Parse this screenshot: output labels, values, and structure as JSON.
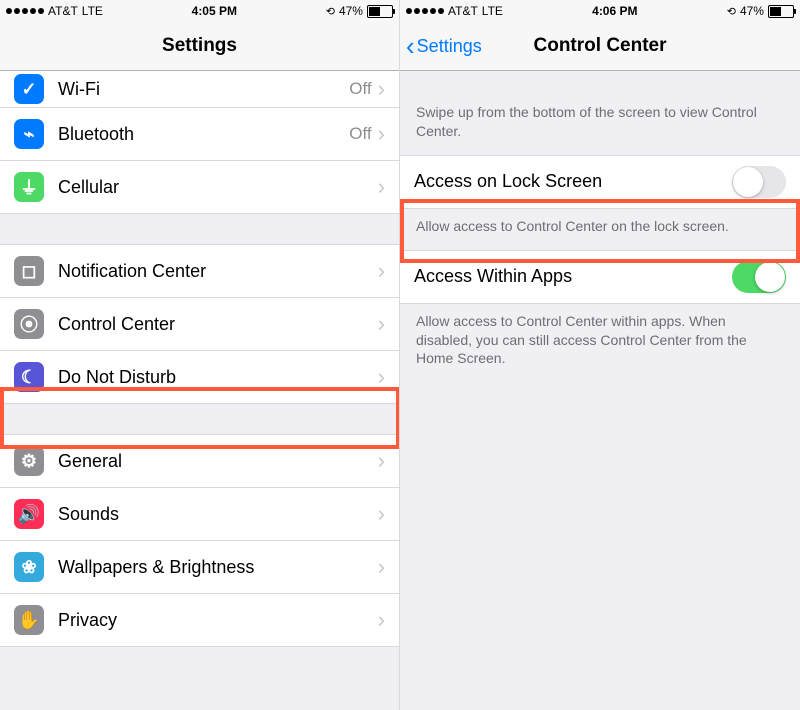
{
  "left": {
    "status": {
      "carrier": "AT&T",
      "network": "LTE",
      "time": "4:05 PM",
      "battery": "47%"
    },
    "title": "Settings",
    "rows": [
      {
        "label": "Wi-Fi",
        "sub": "Off"
      },
      {
        "label": "Bluetooth",
        "sub": "Off"
      },
      {
        "label": "Cellular"
      },
      {
        "label": "Notification Center"
      },
      {
        "label": "Control Center"
      },
      {
        "label": "Do Not Disturb"
      },
      {
        "label": "General"
      },
      {
        "label": "Sounds"
      },
      {
        "label": "Wallpapers & Brightness"
      },
      {
        "label": "Privacy"
      }
    ]
  },
  "right": {
    "status": {
      "carrier": "AT&T",
      "network": "LTE",
      "time": "4:06 PM",
      "battery": "47%"
    },
    "back": "Settings",
    "title": "Control Center",
    "hint1": "Swipe up from the bottom of the screen to view Control Center.",
    "toggles": [
      {
        "label": "Access on Lock Screen",
        "on": false,
        "footer": "Allow access to Control Center on the lock screen."
      },
      {
        "label": "Access Within Apps",
        "on": true,
        "footer": "Allow access to Control Center within apps. When disabled, you can still access Control Center from the Home Screen."
      }
    ]
  },
  "highlight_color": "#ff5a3c",
  "accent_color": "#007aff",
  "switch_on_color": "#4cd964"
}
